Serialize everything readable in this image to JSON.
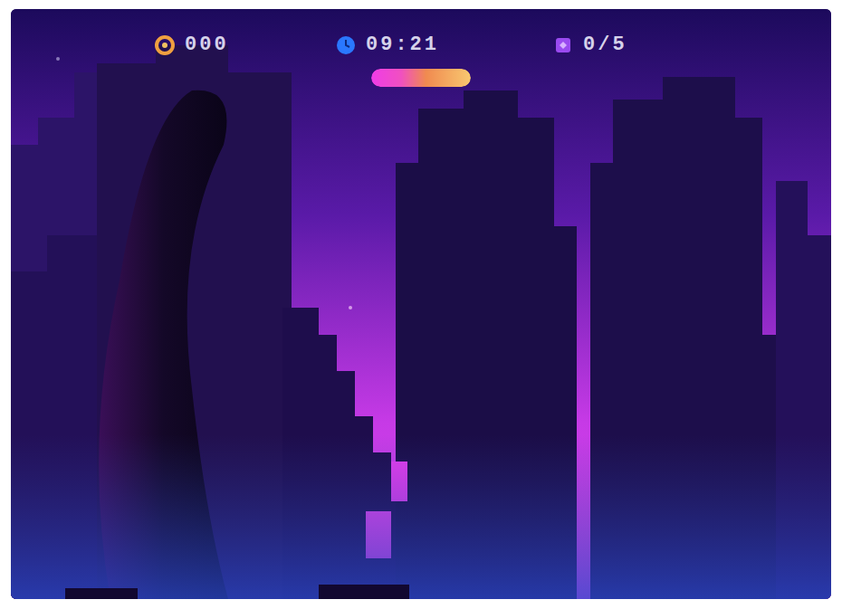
{
  "hud": {
    "coins": "000",
    "time": "09:21",
    "gems": "0/5"
  },
  "power_bar": {
    "level": 1
  }
}
